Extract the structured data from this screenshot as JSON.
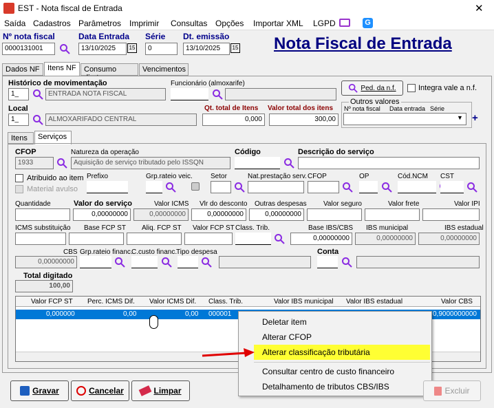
{
  "window": {
    "title": "EST - Nota fiscal de Entrada",
    "close_symbol": "✕"
  },
  "menu": [
    "Saída",
    "Cadastros",
    "Parâmetros",
    "Imprimir",
    "Consultas",
    "Opções",
    "Importar XML",
    "LGPD"
  ],
  "header": {
    "nota_label": "Nº nota fiscal",
    "nota_value": "0000131001",
    "data_entrada_label": "Data Entrada",
    "data_entrada_value": "13/10/2025",
    "serie_label": "Série",
    "serie_value": "0",
    "dt_emissao_label": "Dt. emissão",
    "dt_emissao_value": "13/10/2025",
    "calendar_text": "15",
    "page_title": "Nota Fiscal de Entrada"
  },
  "main_tabs": [
    "Dados NF",
    "Itens NF",
    "Consumo direto",
    "Vencimentos"
  ],
  "itens_nf": {
    "historico_label": "Histórico de movimentação",
    "historico_code": "1_",
    "historico_desc": "ENTRADA NOTA FISCAL",
    "funcionario_label": "Funcionário (almoxarife)",
    "ped_button": "Ped. da n.f.",
    "integra_label": "Integra vale a n.f.",
    "local_label": "Local",
    "local_code": "1_",
    "local_desc": "ALMOXARIFADO CENTRAL",
    "qt_total_label": "Qt. total de Itens",
    "qt_total_value": "0,000",
    "valor_total_label": "Valor total dos itens",
    "valor_total_value": "300,00",
    "outros_valores_label": "Outros valores",
    "outros_cols": [
      "Nº nota fiscal",
      "Data entrada",
      "Série"
    ],
    "plus_symbol": "+"
  },
  "sub_tabs": [
    "Itens",
    "Serviços"
  ],
  "servicos": {
    "cfop_label": "CFOP",
    "cfop_value": "1933",
    "natureza_label": "Natureza da operação",
    "natureza_value": "Aquisição de serviço tributado pelo ISSQN",
    "codigo_label": "Código",
    "descricao_label": "Descrição do serviço",
    "atribuido_label": "Atribuido ao item",
    "material_label": "Material avulso",
    "prefixo_label": "Prefixo",
    "grp_rateio_veic_label": "Grp.rateio veic.",
    "setor_label": "Setor",
    "nat_prest_label": "Nat.prestação serv.",
    "cfop2_label": "CFOP",
    "op_label": "OP",
    "cod_ncm_label": "Cód.NCM",
    "cst_label": "CST",
    "quantidade_label": "Quantidade",
    "valor_servico_label": "Valor do serviço",
    "valor_servico_value": "0,00000000",
    "valor_icms_label": "Valor ICMS",
    "valor_icms_value": "0,00000000",
    "vlr_desconto_label": "Vlr do desconto",
    "vlr_desconto_value": "0,00000000",
    "outras_despesas_label": "Outras despesas",
    "outras_despesas_value": "0,00000000",
    "valor_seguro_label": "Valor seguro",
    "valor_frete_label": "Valor frete",
    "valor_ipi_label": "Valor IPI",
    "icms_subst_label": "ICMS substituição",
    "base_fcp_st_label": "Base FCP ST",
    "aliq_fcp_st_label": "Aliq. FCP ST",
    "valor_fcp_st_label": "Valor FCP ST",
    "class_trib_label": "Class. Trib.",
    "base_ibs_label": "Base IBS/CBS",
    "base_ibs_value": "0,00000000",
    "ibs_municipal_label": "IBS municipal",
    "ibs_municipal_value": "0,00000000",
    "ibs_estadual_label": "IBS estadual",
    "ibs_estadual_value": "0,00000000",
    "cbs_label": "CBS",
    "cbs_value": "0,00000000",
    "grp_rateio_financ_label": "Grp.rateio financ.",
    "c_custo_label": "C.custo financ.",
    "tipo_despesa_label": "Tipo despesa",
    "conta_label": "Conta",
    "total_digitado_label": "Total digitado",
    "total_digitado_value": "100,00"
  },
  "grid": {
    "columns": [
      "Valor FCP ST",
      "Perc. ICMS Dif.",
      "Valor ICMS Dif.",
      "Class. Trib.",
      "Valor IBS municipal",
      "Valor IBS estadual",
      "Valor CBS"
    ],
    "row": [
      "0,000000",
      "0,00",
      "0,00",
      "000001",
      "",
      "",
      "0,9000000000"
    ]
  },
  "context_menu": {
    "items": [
      "Deletar item",
      "Alterar CFOP",
      "Alterar classificação tributária",
      "Consultar centro de custo financeiro",
      "Detalhamento de tributos CBS/IBS"
    ],
    "highlight_color": "#ffff33"
  },
  "footer": {
    "gravar": "Gravar",
    "cancelar": "Cancelar",
    "limpar": "Limpar",
    "excluir": "Excluir"
  },
  "colors": {
    "accent_blue": "#00008b",
    "selection": "#0078d7",
    "title_blue": "#000080",
    "magnifier": "#8a2be2"
  }
}
